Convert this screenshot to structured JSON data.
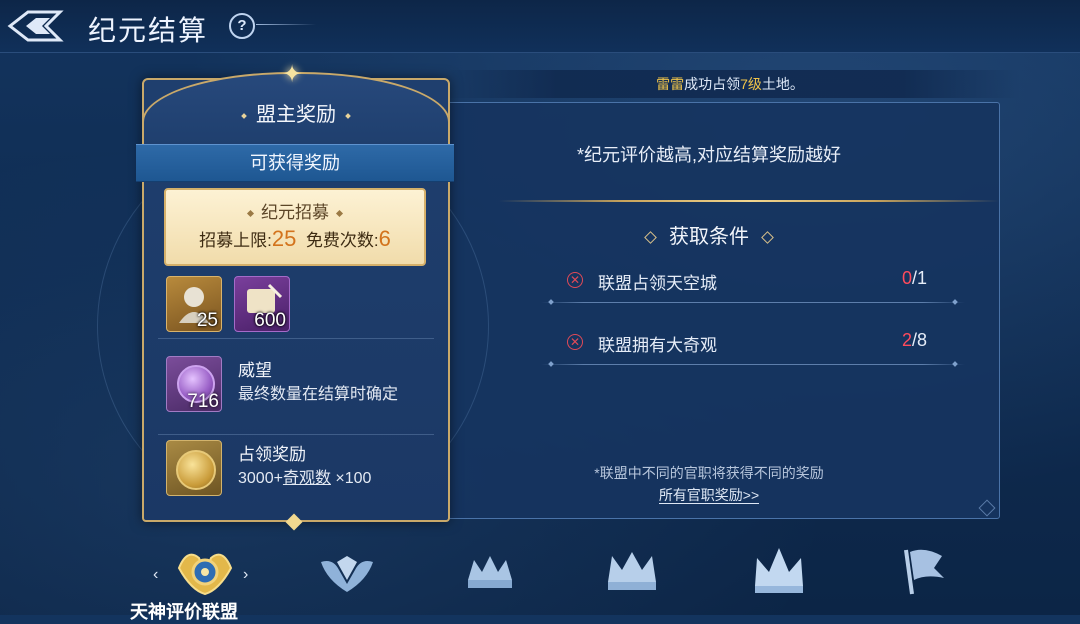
{
  "header": {
    "title": "纪元结算",
    "help": "?"
  },
  "banner": {
    "name": "雷雷",
    "mid": "成功占领",
    "level": "7级",
    "suffix": "土地。"
  },
  "card": {
    "title": "盟主奖励",
    "ribbon": "可获得奖励",
    "recruit": {
      "title": "纪元招募",
      "limit_label": "招募上限:",
      "limit_value": "25",
      "free_label": "免费次数:",
      "free_value": "6"
    },
    "items": [
      {
        "icon": "bust-statue-icon",
        "count": "25"
      },
      {
        "icon": "scroll-quill-icon",
        "count": "600"
      }
    ],
    "prestige": {
      "name": "威望",
      "desc": "最终数量在结算时确定",
      "count": "716",
      "icon": "prestige-medal-icon"
    },
    "occupy": {
      "name": "占领奖励",
      "desc_a": "3000+",
      "desc_b": "奇观数",
      "desc_c": " ×100",
      "icon": "gold-coin-icon"
    }
  },
  "panel": {
    "tip": "*纪元评价越高,对应结算奖励越好",
    "conditions_title": "获取条件",
    "conditions": [
      {
        "label": "联盟占领天空城",
        "current": "0",
        "total": "/1"
      },
      {
        "label": "联盟拥有大奇观",
        "current": "2",
        "total": "/8"
      }
    ],
    "note": "*联盟中不同的官职将获得不同的奖励",
    "link": "所有官职奖励>>"
  },
  "tiers": {
    "selected_label": "天神评价联盟",
    "items": [
      "gold-wings-emblem-icon",
      "winged-diamond-icon",
      "laurel-crown-icon",
      "jeweled-crown-icon",
      "spiked-crown-icon",
      "flag-icon"
    ]
  },
  "colors": {
    "accent_gold": "#f0c44a",
    "fail_red": "#ff4b5c",
    "panel_bg": "#16345f"
  }
}
